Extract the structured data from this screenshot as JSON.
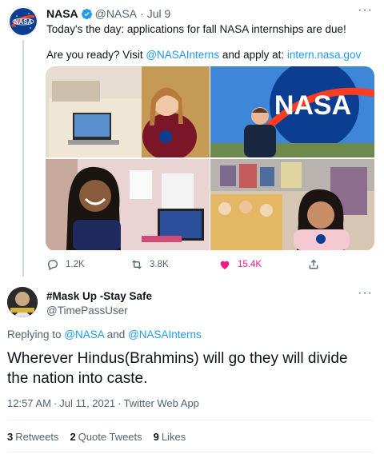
{
  "parent_tweet": {
    "author_name": "NASA",
    "handle": "@NASA",
    "date": "Jul 9",
    "text_line1": "Today's the day: applications for fall NASA internships are due!",
    "text_line2_prefix": "Are you ready? Visit ",
    "mention": "@NASAInterns",
    "text_line2_mid": " and apply at: ",
    "url": "intern.nasa.gov",
    "check_emoji": "✓",
    "avatar_label": "NASA",
    "photos": [
      {
        "sign_text": ""
      },
      {
        "sign_text": "NASA"
      },
      {
        "sign_text": ""
      },
      {
        "sign_text": ""
      }
    ],
    "actions": {
      "replies": "1.2K",
      "retweets": "3.8K",
      "likes": "15.4K"
    },
    "colors": {
      "like": "#f91880",
      "link": "#1d9bf0",
      "muted": "#536471"
    }
  },
  "reply_tweet": {
    "author_name": "#Mask Up -Stay Safe",
    "handle": "@TimePassUser",
    "replying_prefix": "Replying to ",
    "replying_to_1": "@NASA",
    "replying_and": " and ",
    "replying_to_2": "@NASAInterns",
    "body": "Wherever Hindus(Brahmins) will go they will divide the nation into caste.",
    "time": "12:57 AM",
    "date": "Jul 11, 2021",
    "source": "Twitter Web App",
    "stats": [
      {
        "count": "3",
        "label": "Retweets"
      },
      {
        "count": "2",
        "label": "Quote Tweets"
      },
      {
        "count": "9",
        "label": "Likes"
      }
    ]
  }
}
